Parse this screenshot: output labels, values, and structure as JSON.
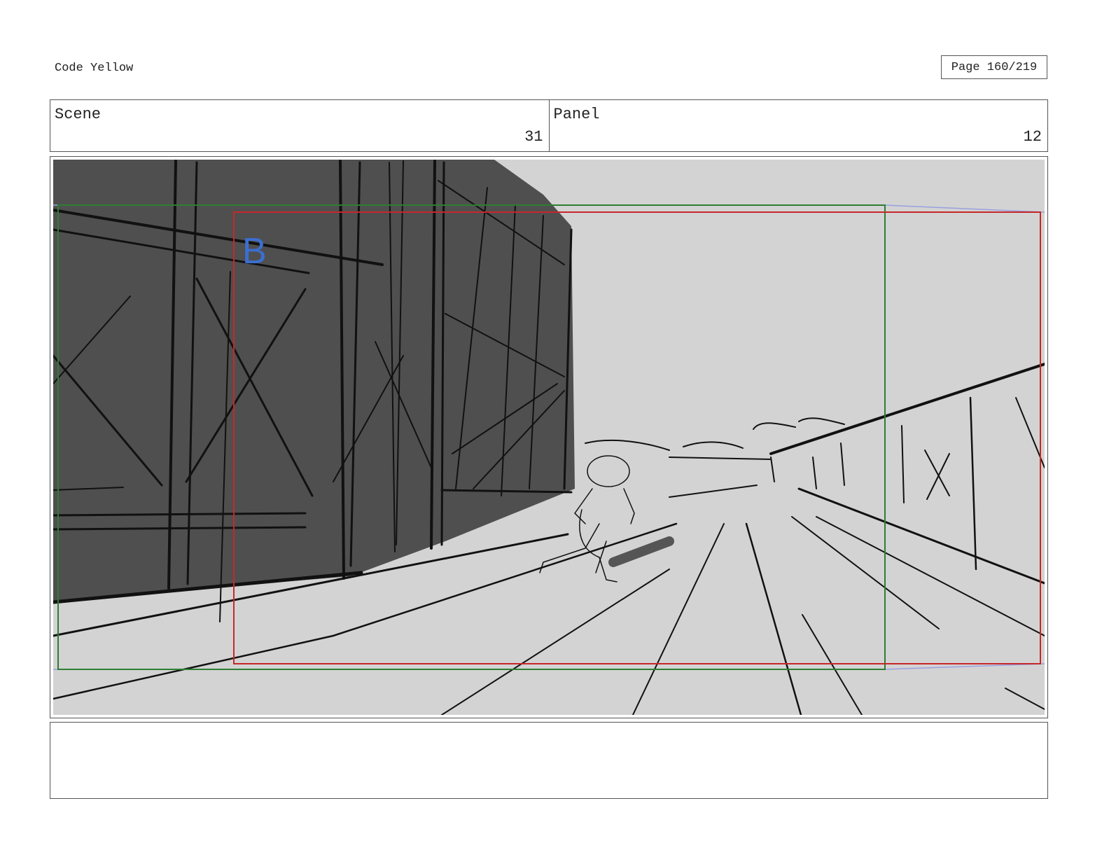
{
  "document": {
    "title": "Code Yellow",
    "page_label": "Page 160/219"
  },
  "header": {
    "scene_label": "Scene",
    "scene_value": "31",
    "panel_label": "Panel",
    "panel_value": "12"
  },
  "panel": {
    "marker_letter": "B",
    "colors": {
      "background": "#d3d3d3",
      "building": "#4f4f4f",
      "ink": "#111111",
      "safe_frame": "#2e7d32",
      "action_frame": "#c62828",
      "marker": "#3b6fd1",
      "guide": "#9aa0e0"
    }
  },
  "notes": {
    "text": ""
  }
}
